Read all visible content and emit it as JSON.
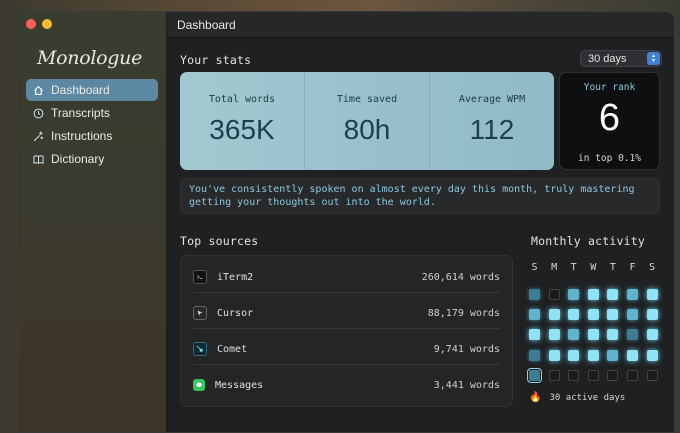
{
  "sidebar": {
    "brand": "Monologue",
    "items": [
      {
        "label": "Dashboard",
        "icon": "home-icon",
        "active": true
      },
      {
        "label": "Transcripts",
        "icon": "clock-icon"
      },
      {
        "label": "Instructions",
        "icon": "sparkle-icon"
      },
      {
        "label": "Dictionary",
        "icon": "book-icon"
      }
    ]
  },
  "window": {
    "title": "Dashboard"
  },
  "stats": {
    "title": "Your stats",
    "range": "30 days",
    "items": [
      {
        "label": "Total words",
        "value": "365K"
      },
      {
        "label": "Time saved",
        "value": "80h"
      },
      {
        "label": "Average WPM",
        "value": "112"
      }
    ],
    "rank": {
      "label": "Your rank",
      "value": "6",
      "sub": "in top 0.1%"
    },
    "message": "You've consistently spoken on almost every day this month, truly mastering getting your thoughts out into the world."
  },
  "sources": {
    "title": "Top sources",
    "items": [
      {
        "name": "iTerm2",
        "count": "260,614 words",
        "icon": "terminal-icon"
      },
      {
        "name": "Cursor",
        "count": "88,179 words",
        "icon": "cursor-app-icon"
      },
      {
        "name": "Comet",
        "count": "9,741 words",
        "icon": "comet-icon"
      },
      {
        "name": "Messages",
        "count": "3,441 words",
        "icon": "messages-icon"
      }
    ]
  },
  "activity": {
    "title": "Monthly activity",
    "days": [
      "S",
      "M",
      "T",
      "W",
      "T",
      "F",
      "S"
    ],
    "grid": [
      [
        1,
        0,
        2,
        3,
        3,
        2,
        3
      ],
      [
        2,
        3,
        3,
        3,
        3,
        2,
        3
      ],
      [
        3,
        3,
        2,
        3,
        3,
        1,
        3
      ],
      [
        1,
        3,
        3,
        3,
        2,
        3,
        3
      ],
      [
        4,
        0,
        0,
        0,
        0,
        0,
        0
      ]
    ],
    "summary": "30 active days",
    "colors": {
      "accent": "#8fe3f5",
      "sidebar_active": "#5c88a3",
      "stats_card": "#9fc4cf"
    }
  }
}
